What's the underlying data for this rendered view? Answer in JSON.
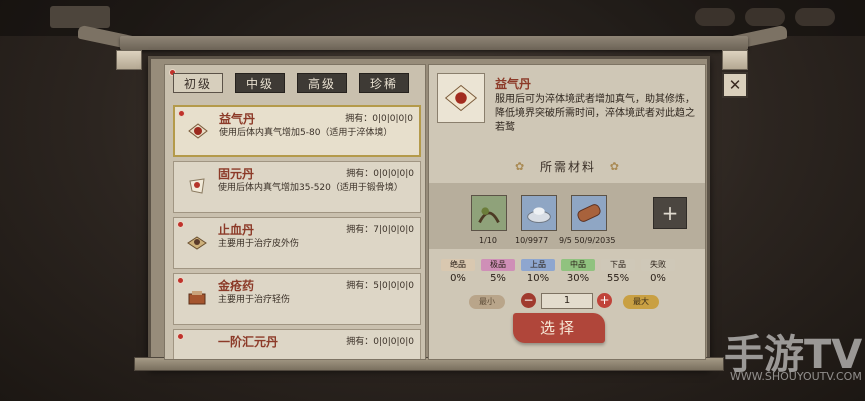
{
  "top_nav": {
    "tabs": [
      "",
      "",
      "",
      ""
    ]
  },
  "tabs": [
    "初级",
    "中级",
    "高级",
    "珍稀"
  ],
  "items": [
    {
      "name": "益气丹",
      "owned": "拥有：0|0|0|0|0",
      "desc": "使用后体内真气增加5-80（适用于淬体境）"
    },
    {
      "name": "固元丹",
      "owned": "拥有：0|0|0|0|0",
      "desc": "使用后体内真气增加35-520（适用于锻骨境）"
    },
    {
      "name": "止血丹",
      "owned": "拥有：7|0|0|0|0",
      "desc": "主要用于治疗皮外伤"
    },
    {
      "name": "金疮药",
      "owned": "拥有：5|0|0|0|0",
      "desc": "主要用于治疗轻伤"
    },
    {
      "name": "一阶汇元丹",
      "owned": "拥有：0|0|0|0|0",
      "desc": ""
    }
  ],
  "detail": {
    "name": "益气丹",
    "desc": "服用后可为淬体境武者增加真气，助其修炼，降低境界突破所需时间，淬体境武者对此趋之若鹜"
  },
  "materials_header": "所需材料",
  "materials": [
    {
      "name": "草药",
      "count": "1/10"
    },
    {
      "name": "银锭",
      "count": "10/9977"
    },
    {
      "name": "木材",
      "count": "9/5 50/9/2035"
    }
  ],
  "qualities": [
    {
      "label": "绝品",
      "value": "0%",
      "color": "#d9c8b0"
    },
    {
      "label": "极品",
      "value": "5%",
      "color": "#cf8fb7"
    },
    {
      "label": "上品",
      "value": "10%",
      "color": "#8ea6cf"
    },
    {
      "label": "中品",
      "value": "30%",
      "color": "#90c27f"
    },
    {
      "label": "下品",
      "value": "55%",
      "color": "#cfc8b8"
    },
    {
      "label": "失败",
      "value": "0%",
      "color": "#cfc8b8"
    }
  ],
  "quantity": {
    "min_label": "最小",
    "max_label": "最大",
    "value": "1"
  },
  "select_label": "选择",
  "close_label": "✕",
  "watermark": {
    "main": "手游TV",
    "sub": "WWW.SHOUYOUTV.COM"
  }
}
